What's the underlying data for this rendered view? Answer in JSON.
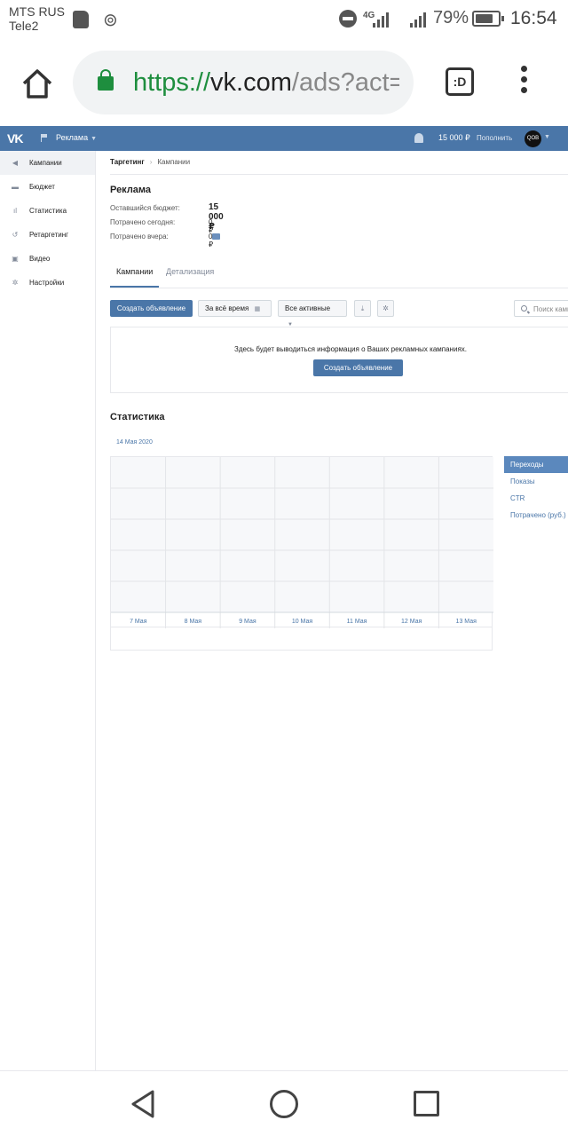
{
  "status_bar": {
    "carrier_1": "MTS RUS",
    "carrier_2": "Tele2",
    "network": "4G",
    "battery": "79%",
    "battery_level": 0.79,
    "time": "16:54"
  },
  "browser": {
    "url_scheme": "https://",
    "url_host": "vk.com",
    "url_path": "/ads?act=",
    "tabs_label": ":D"
  },
  "vk_header": {
    "logo": "VK",
    "section": "Реклама",
    "balance": "15 000 ₽",
    "topup": "Пополнить",
    "avatar_text": "QOB"
  },
  "sidebar": {
    "items": [
      {
        "label": "Кампании",
        "icon": "megaphone-icon",
        "active": true
      },
      {
        "label": "Бюджет",
        "icon": "wallet-icon"
      },
      {
        "label": "Статистика",
        "icon": "bar-chart-icon"
      },
      {
        "label": "Ретаргетинг",
        "icon": "retarget-icon"
      },
      {
        "label": "Видео",
        "icon": "video-icon"
      },
      {
        "label": "Настройки",
        "icon": "gear-icon"
      }
    ]
  },
  "breadcrumb": {
    "root": "Таргетинг",
    "current": "Кампании"
  },
  "ads": {
    "title": "Реклама",
    "budget_label": "Оставшийся бюджет:",
    "budget_value": "15 000 ₽",
    "spent_today_label": "Потрачено сегодня:",
    "spent_today_value": "0 ₽",
    "spent_yesterday_label": "Потрачено вчера:",
    "spent_yesterday_value": "0 ₽"
  },
  "tabs": {
    "campaigns": "Кампании",
    "details": "Детализация"
  },
  "toolbar": {
    "create": "Создать объявление",
    "period": "За всё время",
    "filter": "Все активные",
    "search_placeholder": "Поиск кампаний"
  },
  "empty_state": {
    "text": "Здесь будет выводиться информация о Ваших рекламных кампаниях.",
    "create": "Создать объявление"
  },
  "statistics": {
    "title": "Статистика",
    "date": "14 Мая 2020",
    "metrics": [
      "Переходы",
      "Показы",
      "CTR",
      "Потрачено (руб.)"
    ],
    "active_metric": 0
  },
  "chart_data": {
    "type": "line",
    "title": "",
    "x": [
      "7 Мая",
      "8 Мая",
      "9 Мая",
      "10 Мая",
      "11 Мая",
      "12 Мая",
      "13 Мая"
    ],
    "series": [],
    "xlabel": "",
    "ylabel": "",
    "grid": true,
    "legend": "right"
  }
}
